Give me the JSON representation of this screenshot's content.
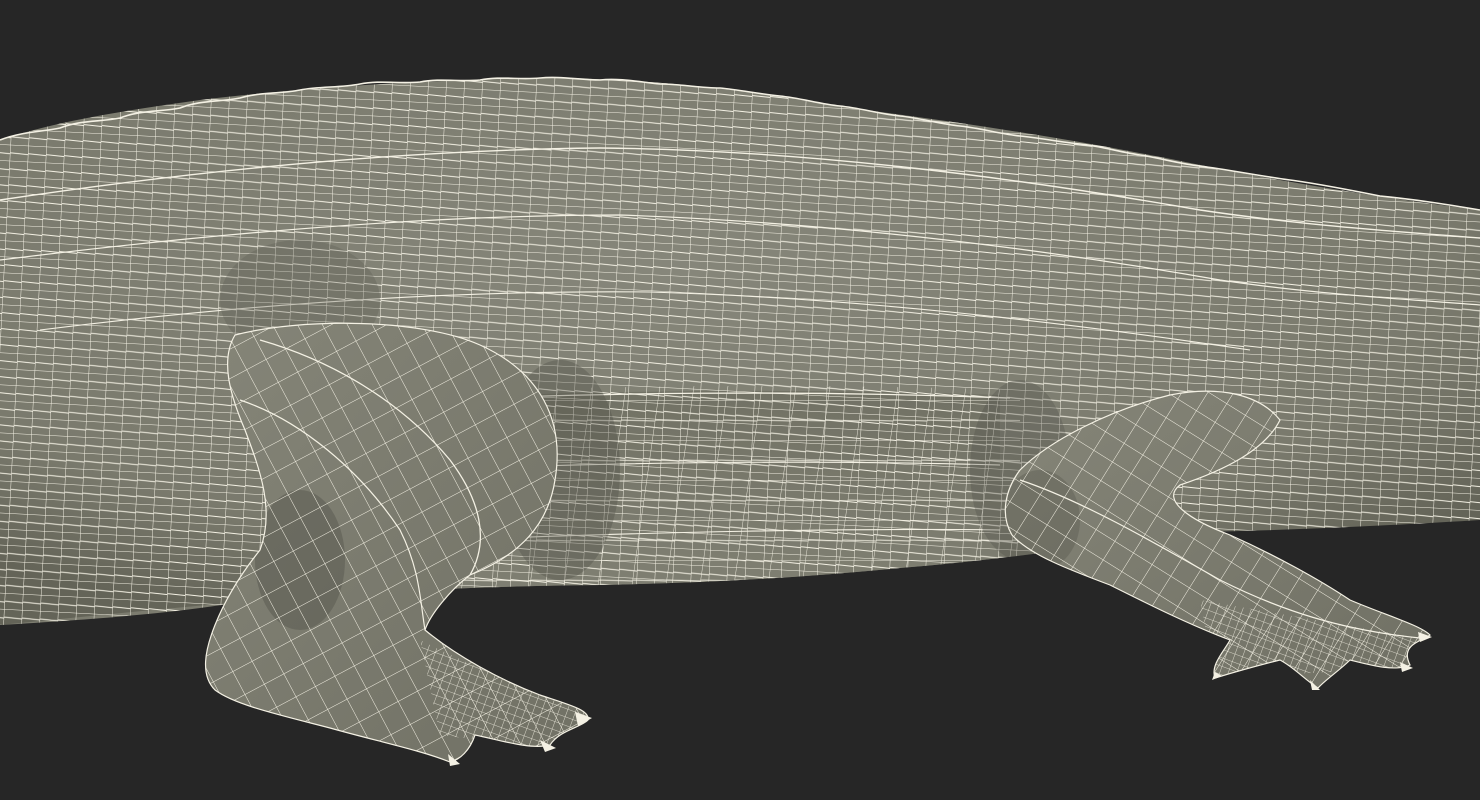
{
  "scene": {
    "subject": "crocodile",
    "render_style": "wireframe",
    "colors": {
      "background": "#262626",
      "body_fill": "#7d7d6f",
      "body_shadow": "#5d5d52",
      "wire": "#f4f1e4"
    },
    "icons": {
      "viewport": "wireframe-mesh-icon"
    }
  }
}
